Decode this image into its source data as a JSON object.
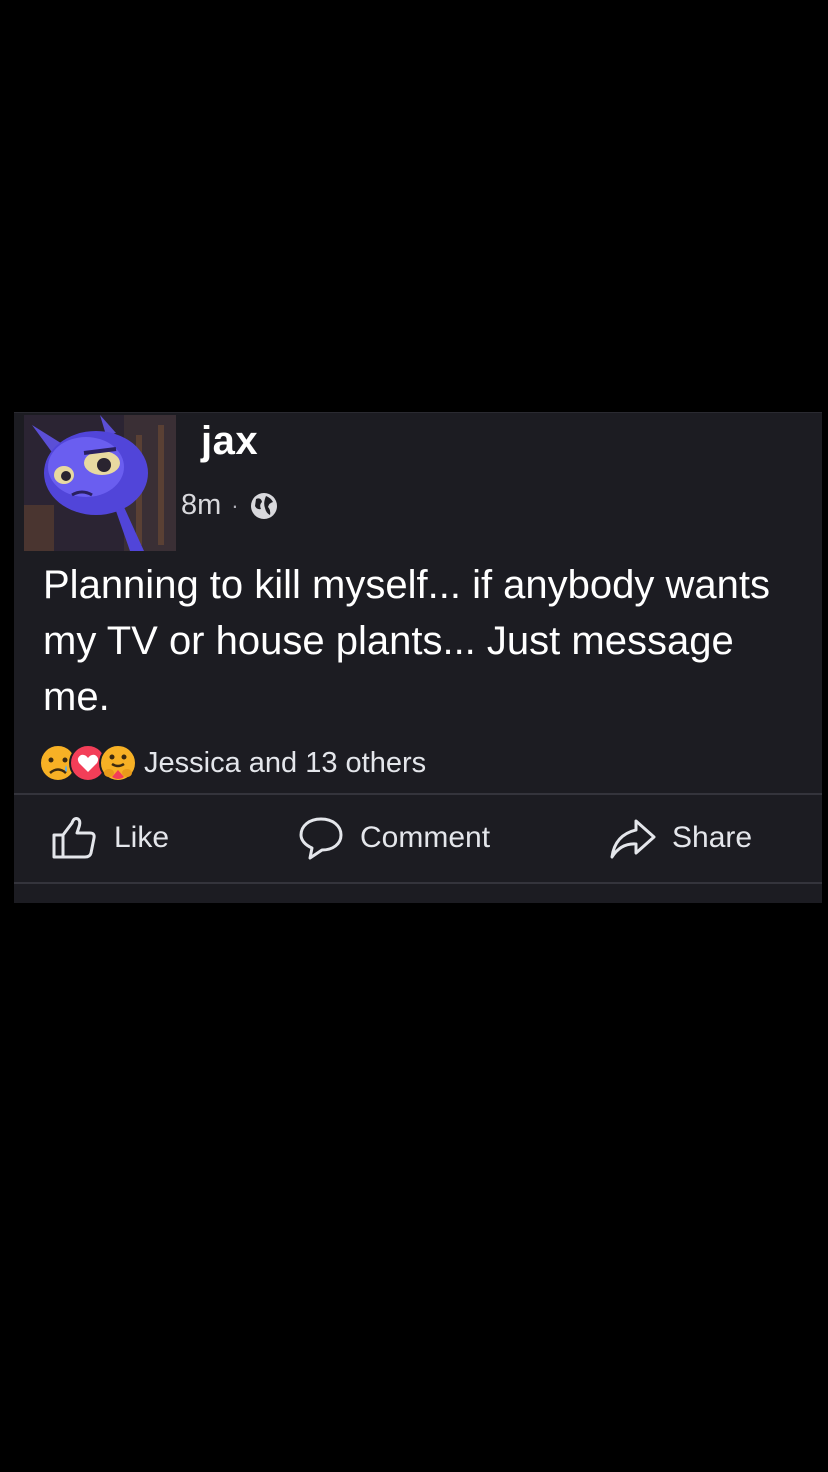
{
  "post": {
    "author": "jax",
    "time": "8m",
    "separator": "·",
    "privacy_icon": "globe-icon",
    "text": "Planning to kill myself... if anybody wants my TV or house plants... Just message me.",
    "reactions": {
      "icons": [
        "sad-face-icon",
        "love-heart-icon",
        "care-hug-icon"
      ],
      "summary": "Jessica and 13 others"
    }
  },
  "actions": {
    "like_label": "Like",
    "comment_label": "Comment",
    "share_label": "Share"
  },
  "colors": {
    "background": "#000000",
    "card": "#1c1c22",
    "text": "#ffffff",
    "love_red": "#f33e58",
    "emoji_yellow": "#f7b125"
  }
}
